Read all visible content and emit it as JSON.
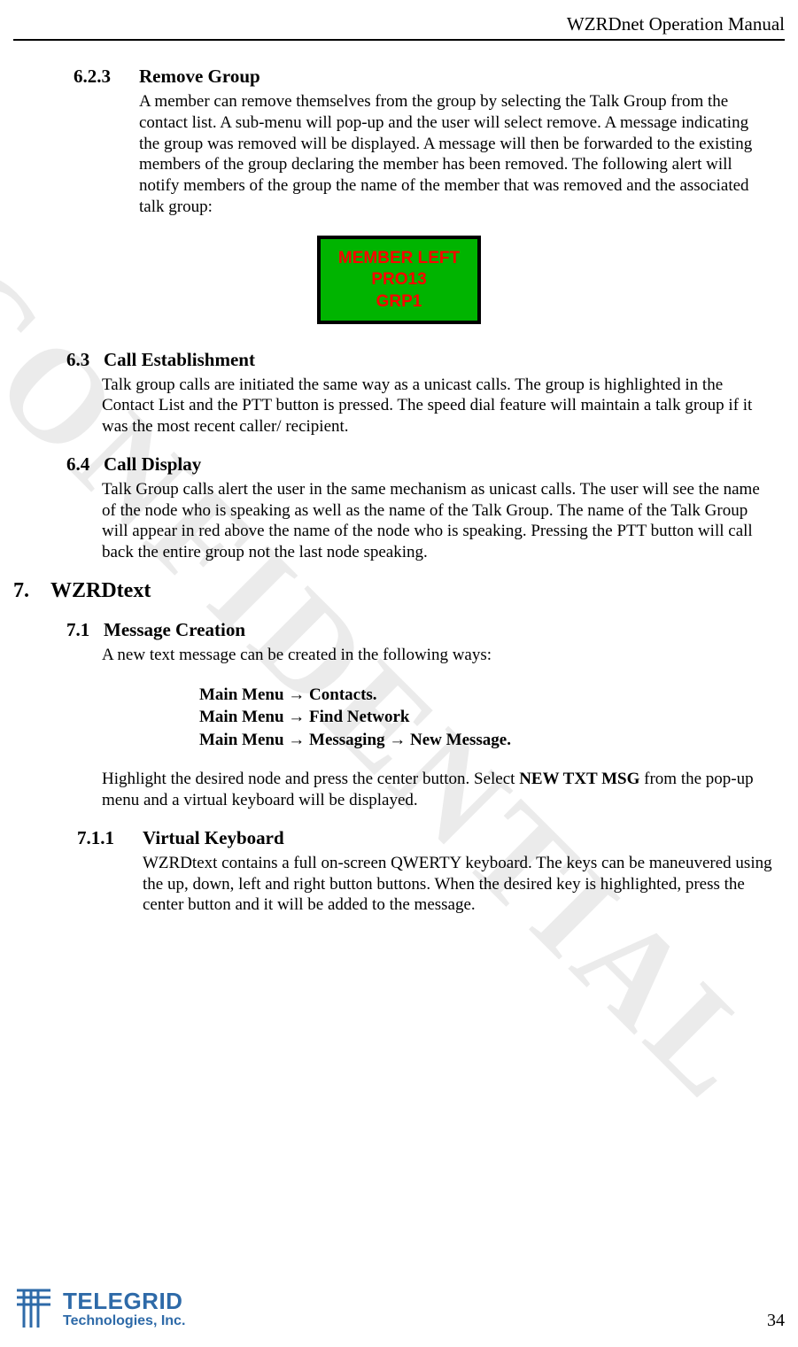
{
  "header": {
    "title": "WZRDnet Operation Manual"
  },
  "sections": {
    "s623": {
      "num": "6.2.3",
      "title": "Remove Group",
      "body": "A member can remove themselves from the group by selecting the Talk Group from the contact list.  A sub-menu will pop-up and the user will select remove.  A message indicating the group was removed will be displayed.  A message will then be forwarded to the existing members of the group declaring the member has been removed.  The following alert will notify members of the group the name of the member that was removed and the associated talk group:"
    },
    "alert": {
      "line1": "MEMBER LEFT",
      "line2": "PRO13",
      "line3": "GRP1"
    },
    "s63": {
      "num": "6.3",
      "title": "Call Establishment",
      "body": "Talk group calls are initiated the same way as a unicast calls.  The group is highlighted in the Contact List and the PTT button is pressed.  The speed dial feature will maintain a talk group if it was the most recent caller/ recipient."
    },
    "s64": {
      "num": "6.4",
      "title": "Call Display",
      "body": "Talk Group calls alert the user in the same mechanism as unicast calls.  The user will see the name of the node who is speaking as well as the name of the Talk Group.  The name of the Talk Group will appear in red above the name of the node who is speaking.  Pressing the PTT button will call back the entire group not the last node speaking."
    },
    "s7": {
      "num": "7.",
      "title": "WZRDtext"
    },
    "s71": {
      "num": "7.1",
      "title": "Message Creation",
      "intro": "A new text message can be created in the following ways:",
      "paths": [
        "Main Menu → Contacts.",
        "Main Menu → Find Network",
        "Main Menu → Messaging → New Message."
      ],
      "body2a": "Highlight the desired node and press the center button.  Select ",
      "body2_bold": "NEW TXT MSG",
      "body2b": " from the pop-up menu and a virtual keyboard will be displayed."
    },
    "s711": {
      "num": "7.1.1",
      "title": "Virtual Keyboard",
      "body": "WZRDtext contains a full on-screen QWERTY keyboard.   The keys can be maneuvered using the up, down, left and right button buttons.  When the desired key is highlighted, press the center button and it will be added to the message."
    }
  },
  "footer": {
    "logo_top": "TELEGRID",
    "logo_bot": "Technologies, Inc.",
    "page_num": "34"
  },
  "watermark": "CONFIDENTIAL"
}
